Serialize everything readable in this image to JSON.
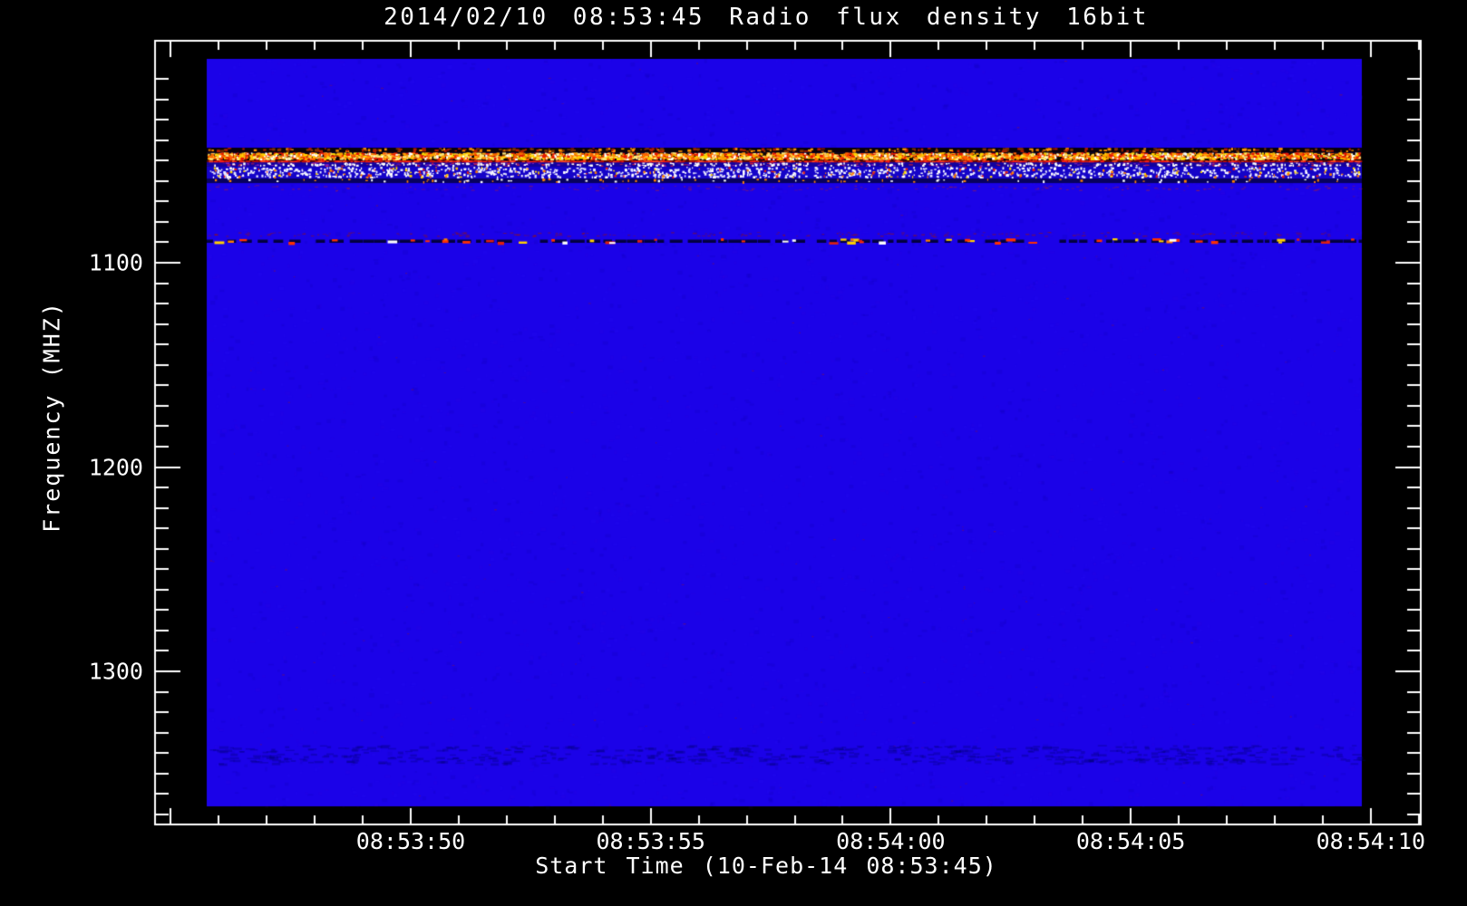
{
  "figure": {
    "background_color": "#000000",
    "text_color": "#ffffff"
  },
  "chart_data": {
    "type": "heatmap",
    "title": "2014/02/10 08:53:45 Radio flux density 16bit",
    "xlabel": "Start Time (10-Feb-14 08:53:45)",
    "ylabel": "Frequency (MHZ)",
    "axes_color": "#ffffff",
    "grid": false,
    "legend": "none",
    "x_axis": {
      "unit": "seconds after 08:53:00",
      "range_s": [
        44.7,
        71.0
      ],
      "minor_step_s": 1,
      "major_ticks": [
        {
          "label": "08:53:50",
          "t": 50
        },
        {
          "label": "08:53:55",
          "t": 55
        },
        {
          "label": "08:54:00",
          "t": 60
        },
        {
          "label": "08:54:05",
          "t": 65
        },
        {
          "label": "08:54:10",
          "t": 70
        }
      ]
    },
    "y_axis": {
      "unit": "MHz",
      "range_mhz": [
        991,
        1375
      ],
      "direction": "increasing-downward",
      "minor_step_mhz": 10,
      "minor_first_mhz": 1010,
      "minor_last_mhz": 1370,
      "major_ticks": [
        {
          "label": "1100",
          "f": 1100
        },
        {
          "label": "1200",
          "f": 1200
        },
        {
          "label": "1300",
          "f": 1300
        }
      ]
    },
    "image": {
      "time_span_s": [
        45.75,
        69.82
      ],
      "freq_span_mhz": [
        1000,
        1366
      ],
      "base_color": "#1B02E8",
      "noise": [
        {
          "colors": [
            "rgba(0,0,130,0.10)",
            "rgba(50,30,255,0.10)",
            "rgba(100,10,200,0.06)"
          ],
          "density": 0.0045,
          "size": [
            4,
            3
          ]
        },
        {
          "colors": [
            "rgba(170,30,15,0.35)"
          ],
          "density": 0.0002,
          "size": [
            2,
            1
          ]
        }
      ],
      "bands": [
        {
          "name": "rfi-dark-upper-edge",
          "freq": [
            1043.7,
            1046.0
          ],
          "bg": "#07000a",
          "speckles": [
            {
              "colors": [
                "#b01800",
                "#ff9000",
                "#803000"
              ],
              "density": 0.05,
              "size": [
                3,
                2
              ]
            }
          ]
        },
        {
          "name": "rfi-yellow-speckle-band",
          "freq": [
            1046.0,
            1049.9
          ],
          "bg": "#0a0400",
          "speckles": [
            {
              "colors": [
                "#ffd800",
                "#ffa000",
                "#ff6000",
                "#e81800",
                "#ffe878"
              ],
              "density": 0.3,
              "size": [
                3,
                2
              ]
            },
            {
              "colors": [
                "#ffffff"
              ],
              "density": 0.02,
              "size": [
                2,
                2
              ]
            }
          ]
        },
        {
          "name": "rfi-red-line",
          "freq": [
            1049.9,
            1050.9
          ],
          "bg": "#5c060c",
          "speckles": [
            {
              "colors": [
                "#ff2010",
                "#ff4a20",
                "#c01008"
              ],
              "density": 0.18,
              "size": [
                4,
                2
              ]
            }
          ]
        },
        {
          "name": "rfi-transition-purple",
          "freq": [
            1050.9,
            1053.0
          ],
          "bg": "#12029e",
          "speckles": [
            {
              "colors": [
                "#8a20c0",
                "#c02040",
                "#3a0a9a"
              ],
              "density": 0.06,
              "size": [
                3,
                1
              ]
            },
            {
              "colors": [
                "#ffffff"
              ],
              "density": 0.05,
              "size": [
                2,
                2
              ]
            }
          ]
        },
        {
          "name": "rfi-white-speckle-band",
          "freq": [
            1053.0,
            1058.8
          ],
          "bg": "#1503c8",
          "speckles": [
            {
              "colors": [
                "#ffffff",
                "#e8e8ff"
              ],
              "density": 0.065,
              "size": [
                2,
                2
              ]
            },
            {
              "colors": [
                "#ffd800",
                "#ff8000",
                "#e82010"
              ],
              "density": 0.012,
              "size": [
                2,
                2
              ]
            }
          ]
        },
        {
          "name": "rfi-navy-lower-edge",
          "freq": [
            1058.8,
            1061.0
          ],
          "bg": "#08015e",
          "speckles": [
            {
              "colors": [
                "#ffffff",
                "#ff8000"
              ],
              "density": 0.015,
              "size": [
                2,
                2
              ]
            }
          ]
        },
        {
          "name": "faint-red-fuzz-below-band",
          "freq": [
            1062.0,
            1065.0
          ],
          "bg": null,
          "speckles": [
            {
              "colors": [
                "rgba(200,40,20,0.40)"
              ],
              "density": 0.02,
              "size": [
                3,
                1
              ]
            }
          ]
        },
        {
          "name": "faint-red-fuzz-above-line",
          "freq": [
            1085.0,
            1087.5
          ],
          "bg": null,
          "speckles": [
            {
              "colors": [
                "rgba(160,20,10,0.50)"
              ],
              "density": 0.03,
              "size": [
                3,
                1
              ]
            }
          ]
        },
        {
          "name": "rfi-dashed-line-1089mhz",
          "freq": [
            1088.0,
            1090.8
          ],
          "type": "dashline",
          "bg": "#03013f",
          "bright_density": 0.045,
          "bright": [
            "#ff3000",
            "#ff3000",
            "#e02010",
            "#ff8000",
            "#ffd000",
            "#ffffff"
          ]
        },
        {
          "name": "subtle-dark-mottling-1340mhz",
          "freq": [
            1336.0,
            1346.0
          ],
          "bg": null,
          "speckles": [
            {
              "colors": [
                "rgba(0,0,110,0.30)"
              ],
              "density": 0.02,
              "size": [
                7,
                2
              ]
            }
          ]
        }
      ]
    }
  }
}
